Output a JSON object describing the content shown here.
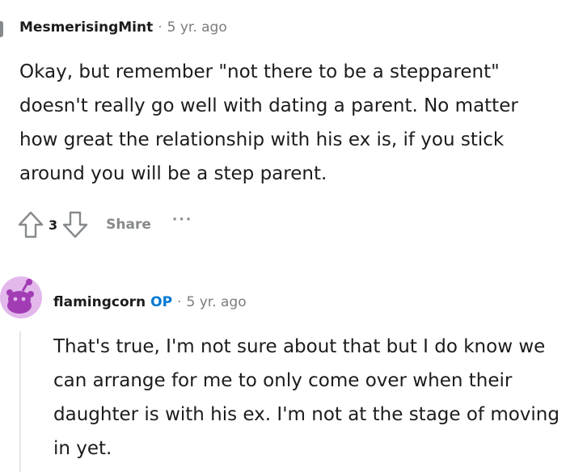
{
  "comments": [
    {
      "author": "MesmerisingMint",
      "separator": "·",
      "time": "5 yr. ago",
      "body": "Okay, but remember \"not there to be a stepparent\" doesn't really go well with dating a parent. No matter how great the relationship with his ex is, if you stick around you will be a step parent.",
      "score": "3",
      "share_label": "Share",
      "more_label": "···"
    },
    {
      "author": "flamingcorn",
      "op_badge": "OP",
      "separator": "·",
      "time": "5 yr. ago",
      "body": "That's true, I'm not sure about that but I do know we can arrange for me to only come over when their daughter is with his ex. I'm not at the stage of moving in yet.",
      "avatar_color": "#e3b9ec"
    }
  ],
  "icons": {
    "upvote": "upvote-arrow-icon",
    "downvote": "downvote-arrow-icon",
    "more": "more-options-icon"
  },
  "colors": {
    "text": "#1c1c1c",
    "muted": "#878a8c",
    "op": "#0079d3"
  }
}
